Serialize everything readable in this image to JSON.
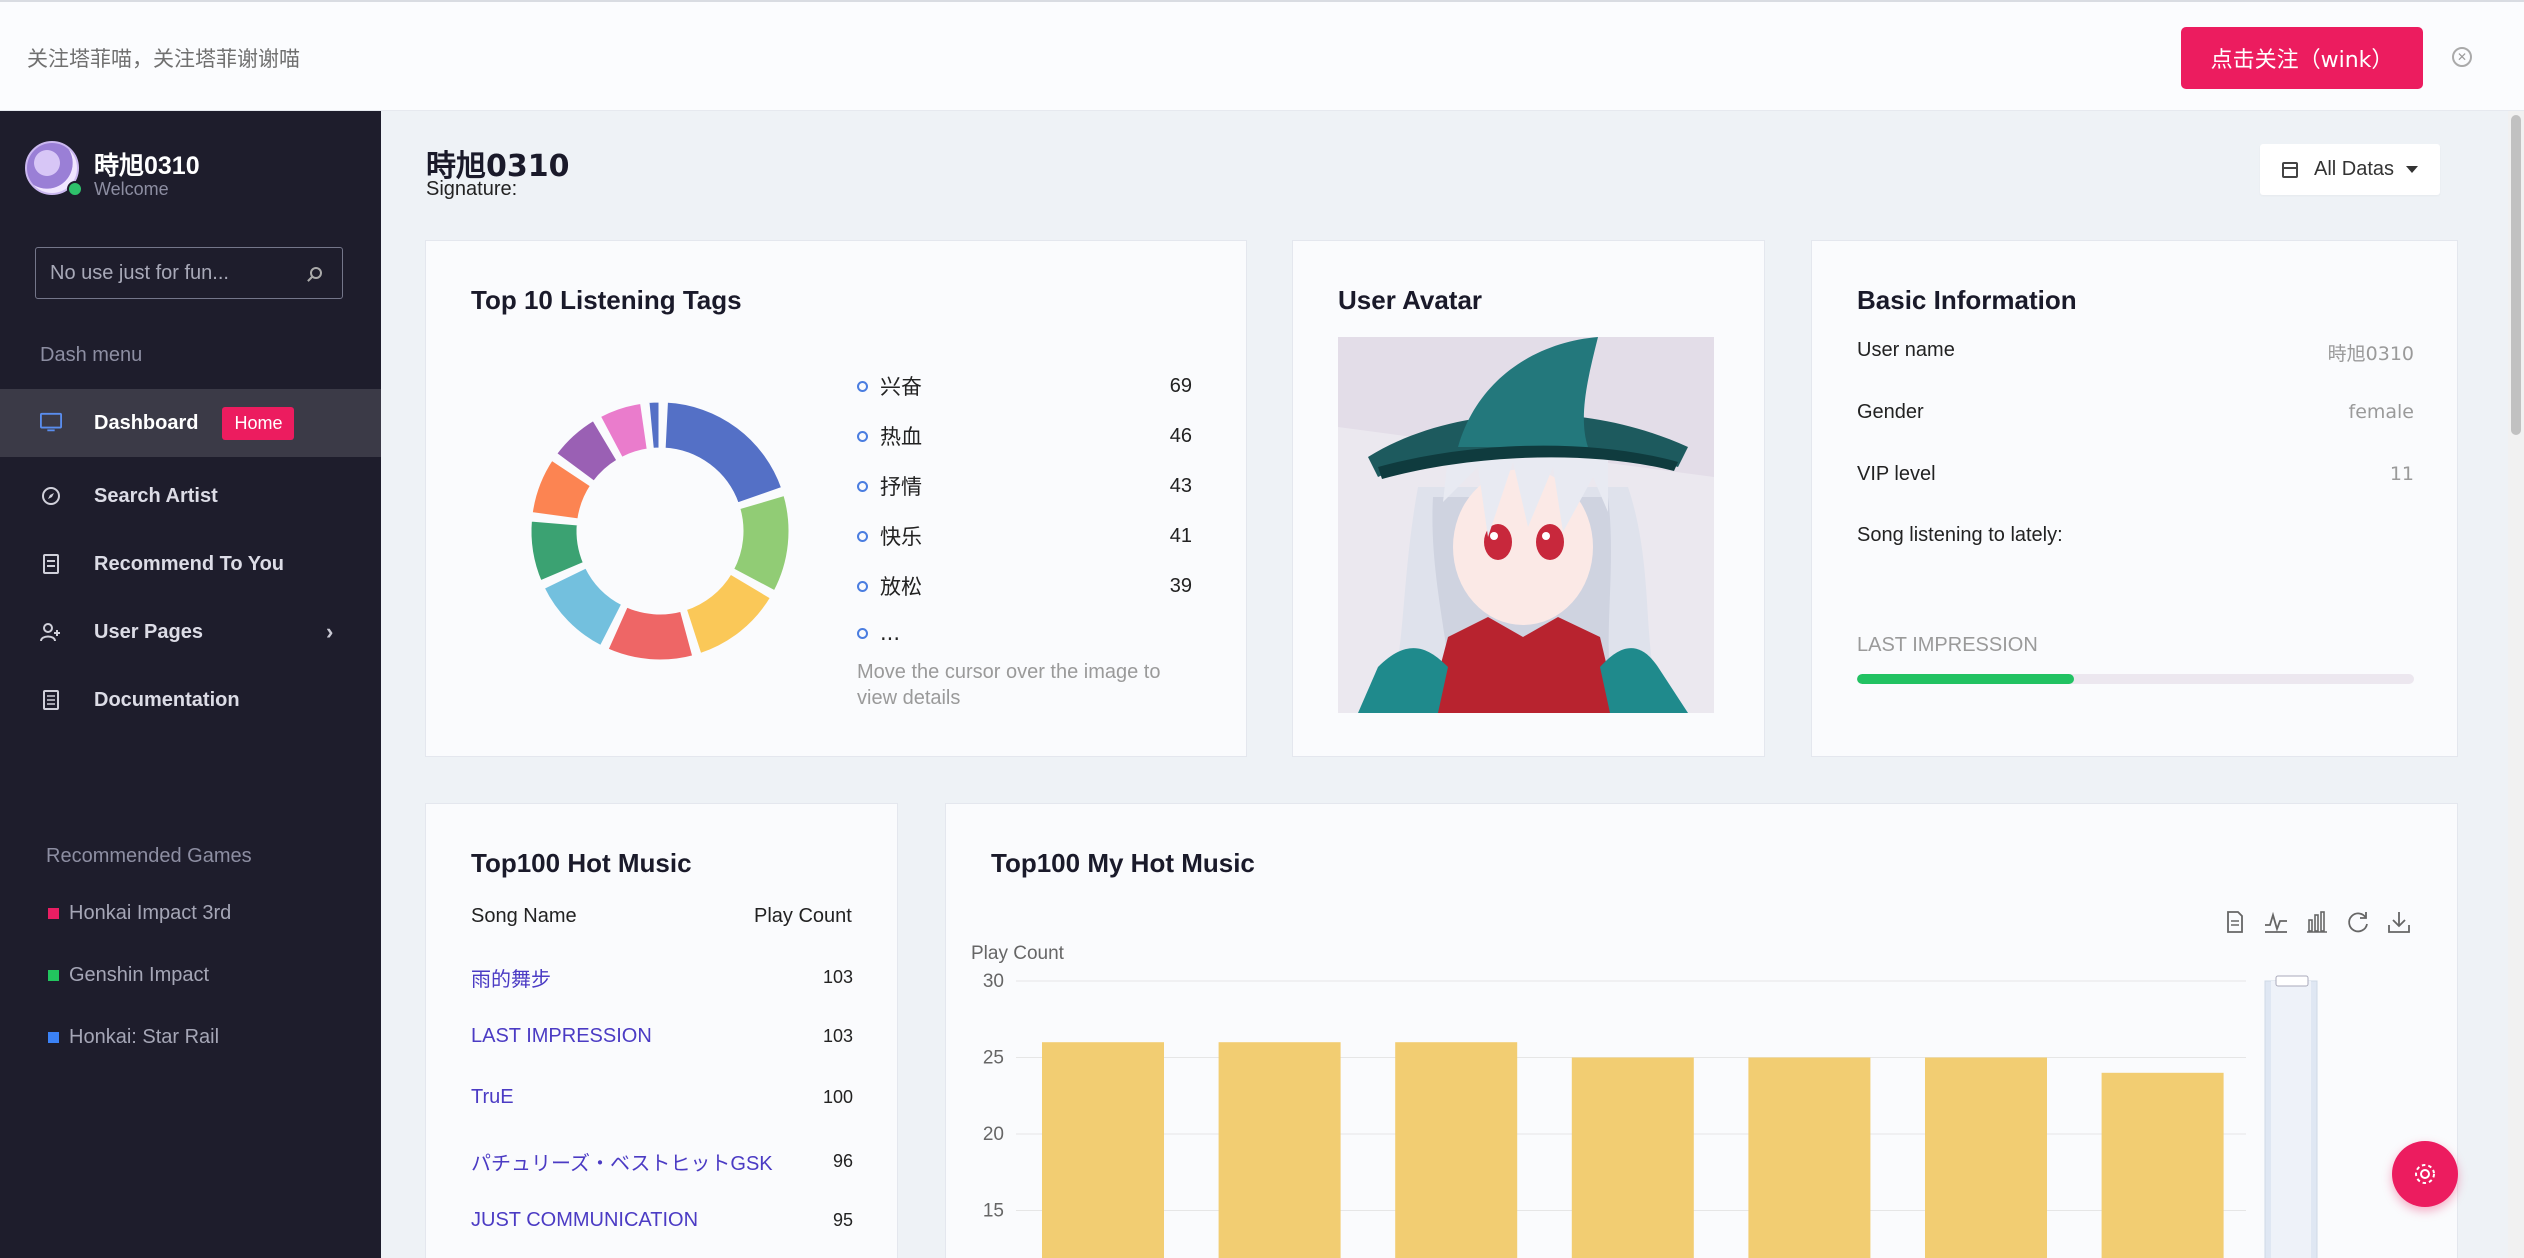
{
  "banner": {
    "message": "关注塔菲喵，关注塔菲谢谢喵",
    "follow_label": "点击关注（wink）"
  },
  "sidebar": {
    "user_name": "時旭0310",
    "welcome": "Welcome",
    "search_placeholder": "No use just for fun...",
    "menu_title": "Dash menu",
    "items": [
      {
        "label": "Dashboard",
        "badge": "Home",
        "icon": "monitor-icon"
      },
      {
        "label": "Search Artist",
        "icon": "compass-icon"
      },
      {
        "label": "Recommend To You",
        "icon": "ticket-icon"
      },
      {
        "label": "User Pages",
        "icon": "user-plus-icon"
      },
      {
        "label": "Documentation",
        "icon": "document-icon"
      }
    ],
    "games_title": "Recommended Games",
    "games": [
      {
        "label": "Honkai Impact 3rd",
        "color": "#e91e63"
      },
      {
        "label": "Genshin Impact",
        "color": "#22c55e"
      },
      {
        "label": "Honkai: Star Rail",
        "color": "#3b82f6"
      }
    ]
  },
  "header": {
    "title": "時旭0310",
    "signature": "Signature:",
    "filter_label": "All Datas"
  },
  "tags_card": {
    "title": "Top 10 Listening Tags",
    "legend": [
      {
        "name": "兴奋",
        "value": "69"
      },
      {
        "name": "热血",
        "value": "46"
      },
      {
        "name": "抒情",
        "value": "43"
      },
      {
        "name": "快乐",
        "value": "41"
      },
      {
        "name": "放松",
        "value": "39"
      },
      {
        "name": "...",
        "value": ""
      }
    ],
    "hint": "Move the cursor over the image to view details",
    "colors": [
      "#5470c6",
      "#91cc75",
      "#fac858",
      "#ee6666",
      "#73c0de",
      "#3ba272",
      "#fc8452",
      "#9a60b4",
      "#ea7ccc",
      "#5470c6"
    ]
  },
  "avatar_card": {
    "title": "User Avatar"
  },
  "info_card": {
    "title": "Basic Information",
    "rows": [
      {
        "label": "User name",
        "value": "時旭0310"
      },
      {
        "label": "Gender",
        "value": "female"
      },
      {
        "label": "VIP level",
        "value": "11"
      },
      {
        "label": "Song listening to lately:",
        "value": ""
      }
    ],
    "lately_song": "LAST IMPRESSION",
    "progress": 0.39
  },
  "hot_music": {
    "title": "Top100 Hot Music",
    "col_song": "Song Name",
    "col_count": "Play Count",
    "rows": [
      {
        "name": "雨的舞步",
        "count": "103"
      },
      {
        "name": "LAST IMPRESSION",
        "count": "103"
      },
      {
        "name": "TruE",
        "count": "100"
      },
      {
        "name": "パチュリーズ・ベストヒットGSK",
        "count": "96"
      },
      {
        "name": "JUST COMMUNICATION",
        "count": "95"
      }
    ]
  },
  "my_hot_music": {
    "title": "Top100 My Hot Music",
    "toolbox": [
      "document-icon",
      "line-chart-icon",
      "bar-chart-icon",
      "refresh-icon",
      "download-icon"
    ]
  },
  "chart_data": {
    "type": "bar",
    "ylabel": "Play Count",
    "y_ticks": [
      "15",
      "20",
      "25",
      "30"
    ],
    "ylim": [
      15,
      30
    ],
    "values": [
      26,
      26,
      26,
      25,
      25,
      25,
      24
    ],
    "color": "#f2cd72"
  }
}
